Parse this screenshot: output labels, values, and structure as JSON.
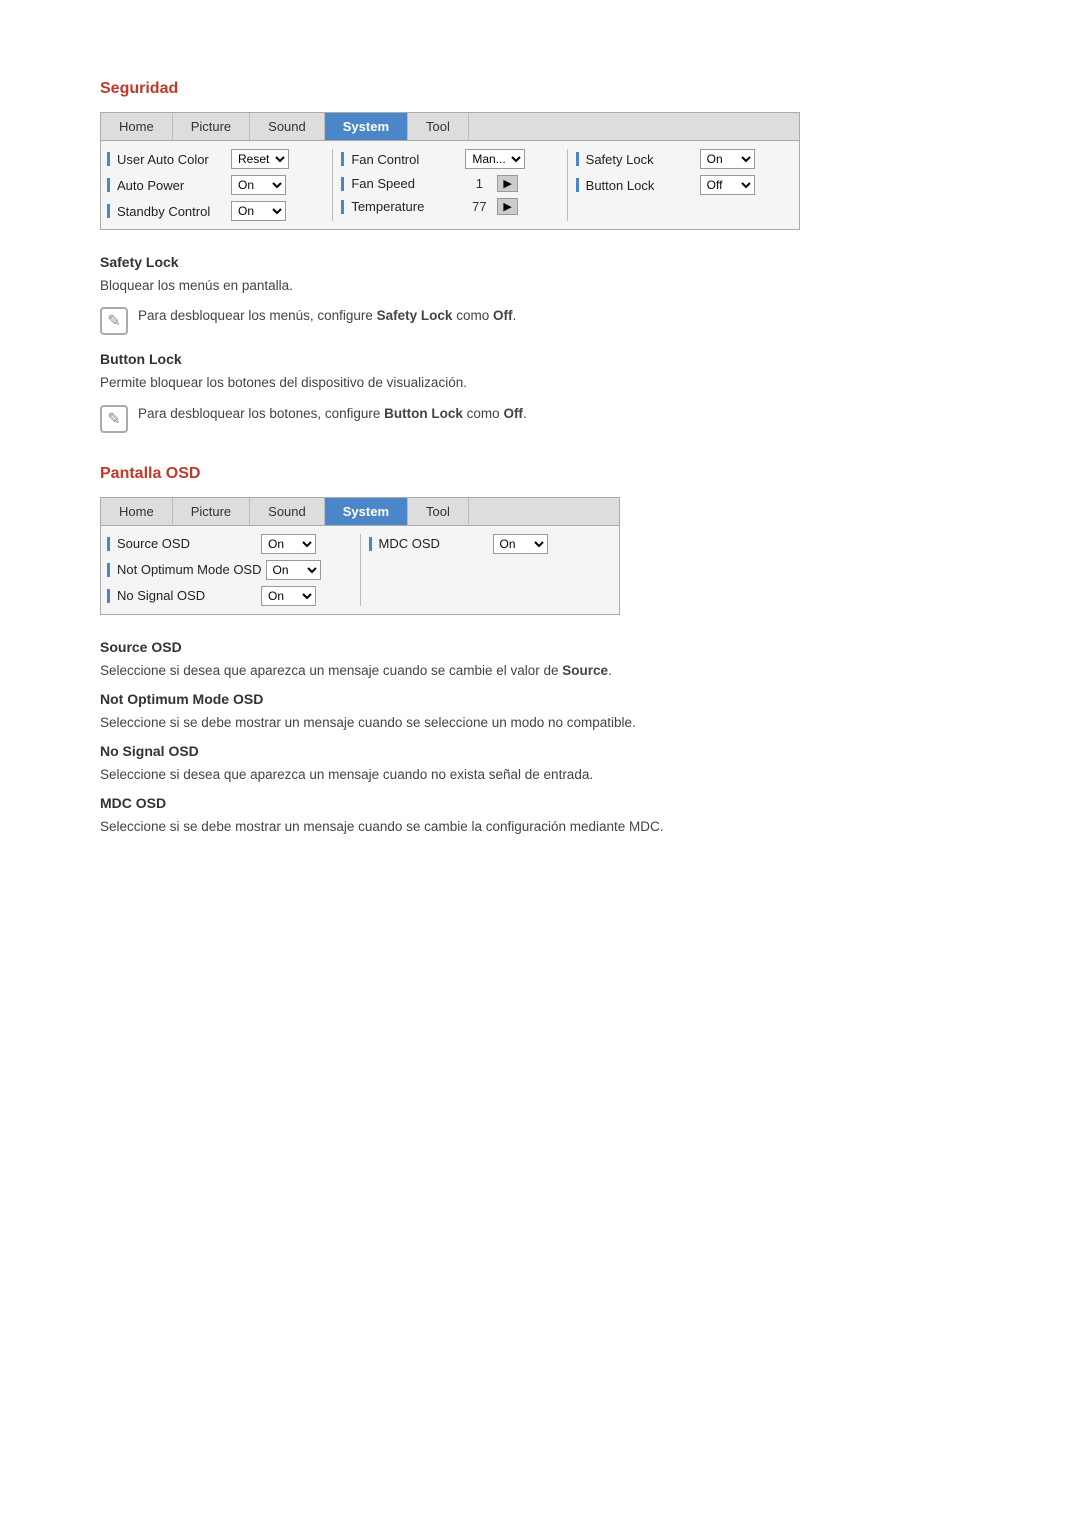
{
  "seguridad": {
    "title": "Seguridad",
    "panel": {
      "tabs": [
        {
          "label": "Home",
          "active": false
        },
        {
          "label": "Picture",
          "active": false
        },
        {
          "label": "Sound",
          "active": false
        },
        {
          "label": "System",
          "active": true
        },
        {
          "label": "Tool",
          "active": false
        }
      ],
      "col1": [
        {
          "label": "User Auto Color",
          "control": "select",
          "value": "Reset"
        },
        {
          "label": "Auto Power",
          "control": "select",
          "value": "On"
        },
        {
          "label": "Standby Control",
          "control": "select",
          "value": "On"
        }
      ],
      "col2": [
        {
          "label": "Fan Control",
          "control": "select",
          "value": "Man..."
        },
        {
          "label": "Fan Speed",
          "control": "arrow",
          "value": "1"
        },
        {
          "label": "Temperature",
          "control": "arrow",
          "value": "77"
        }
      ],
      "col3": [
        {
          "label": "Safety Lock",
          "control": "select",
          "value": "On"
        },
        {
          "label": "Button Lock",
          "control": "select",
          "value": "Off"
        }
      ]
    },
    "safety_lock": {
      "heading": "Safety Lock",
      "body": "Bloquear los menús en pantalla.",
      "note": "Para desbloquear los menús, configure <b>Safety Lock</b> como <b>Off</b>."
    },
    "button_lock": {
      "heading": "Button Lock",
      "body": "Permite bloquear los botones del dispositivo de visualización.",
      "note": "Para desbloquear los botones, configure <b>Button Lock</b> como <b>Off</b>."
    }
  },
  "pantalla_osd": {
    "title": "Pantalla OSD",
    "panel": {
      "tabs": [
        {
          "label": "Home",
          "active": false
        },
        {
          "label": "Picture",
          "active": false
        },
        {
          "label": "Sound",
          "active": false
        },
        {
          "label": "System",
          "active": true
        },
        {
          "label": "Tool",
          "active": false
        }
      ],
      "col1": [
        {
          "label": "Source OSD",
          "control": "select",
          "value": "On"
        },
        {
          "label": "Not Optimum Mode OSD",
          "control": "select",
          "value": "On"
        },
        {
          "label": "No Signal OSD",
          "control": "select",
          "value": "On"
        }
      ],
      "col2": [
        {
          "label": "MDC OSD",
          "control": "select",
          "value": "On"
        }
      ]
    },
    "source_osd": {
      "heading": "Source OSD",
      "body": "Seleccione si desea que aparezca un mensaje cuando se cambie el valor de <b>Source</b>."
    },
    "not_optimum": {
      "heading": "Not Optimum Mode OSD",
      "body": "Seleccione si se debe mostrar un mensaje cuando se seleccione un modo no compatible."
    },
    "no_signal": {
      "heading": "No Signal OSD",
      "body": "Seleccione si desea que aparezca un mensaje cuando no exista señal de entrada."
    },
    "mdc_osd": {
      "heading": "MDC OSD",
      "body": "Seleccione si se debe mostrar un mensaje cuando se cambie la configuración mediante MDC."
    }
  }
}
